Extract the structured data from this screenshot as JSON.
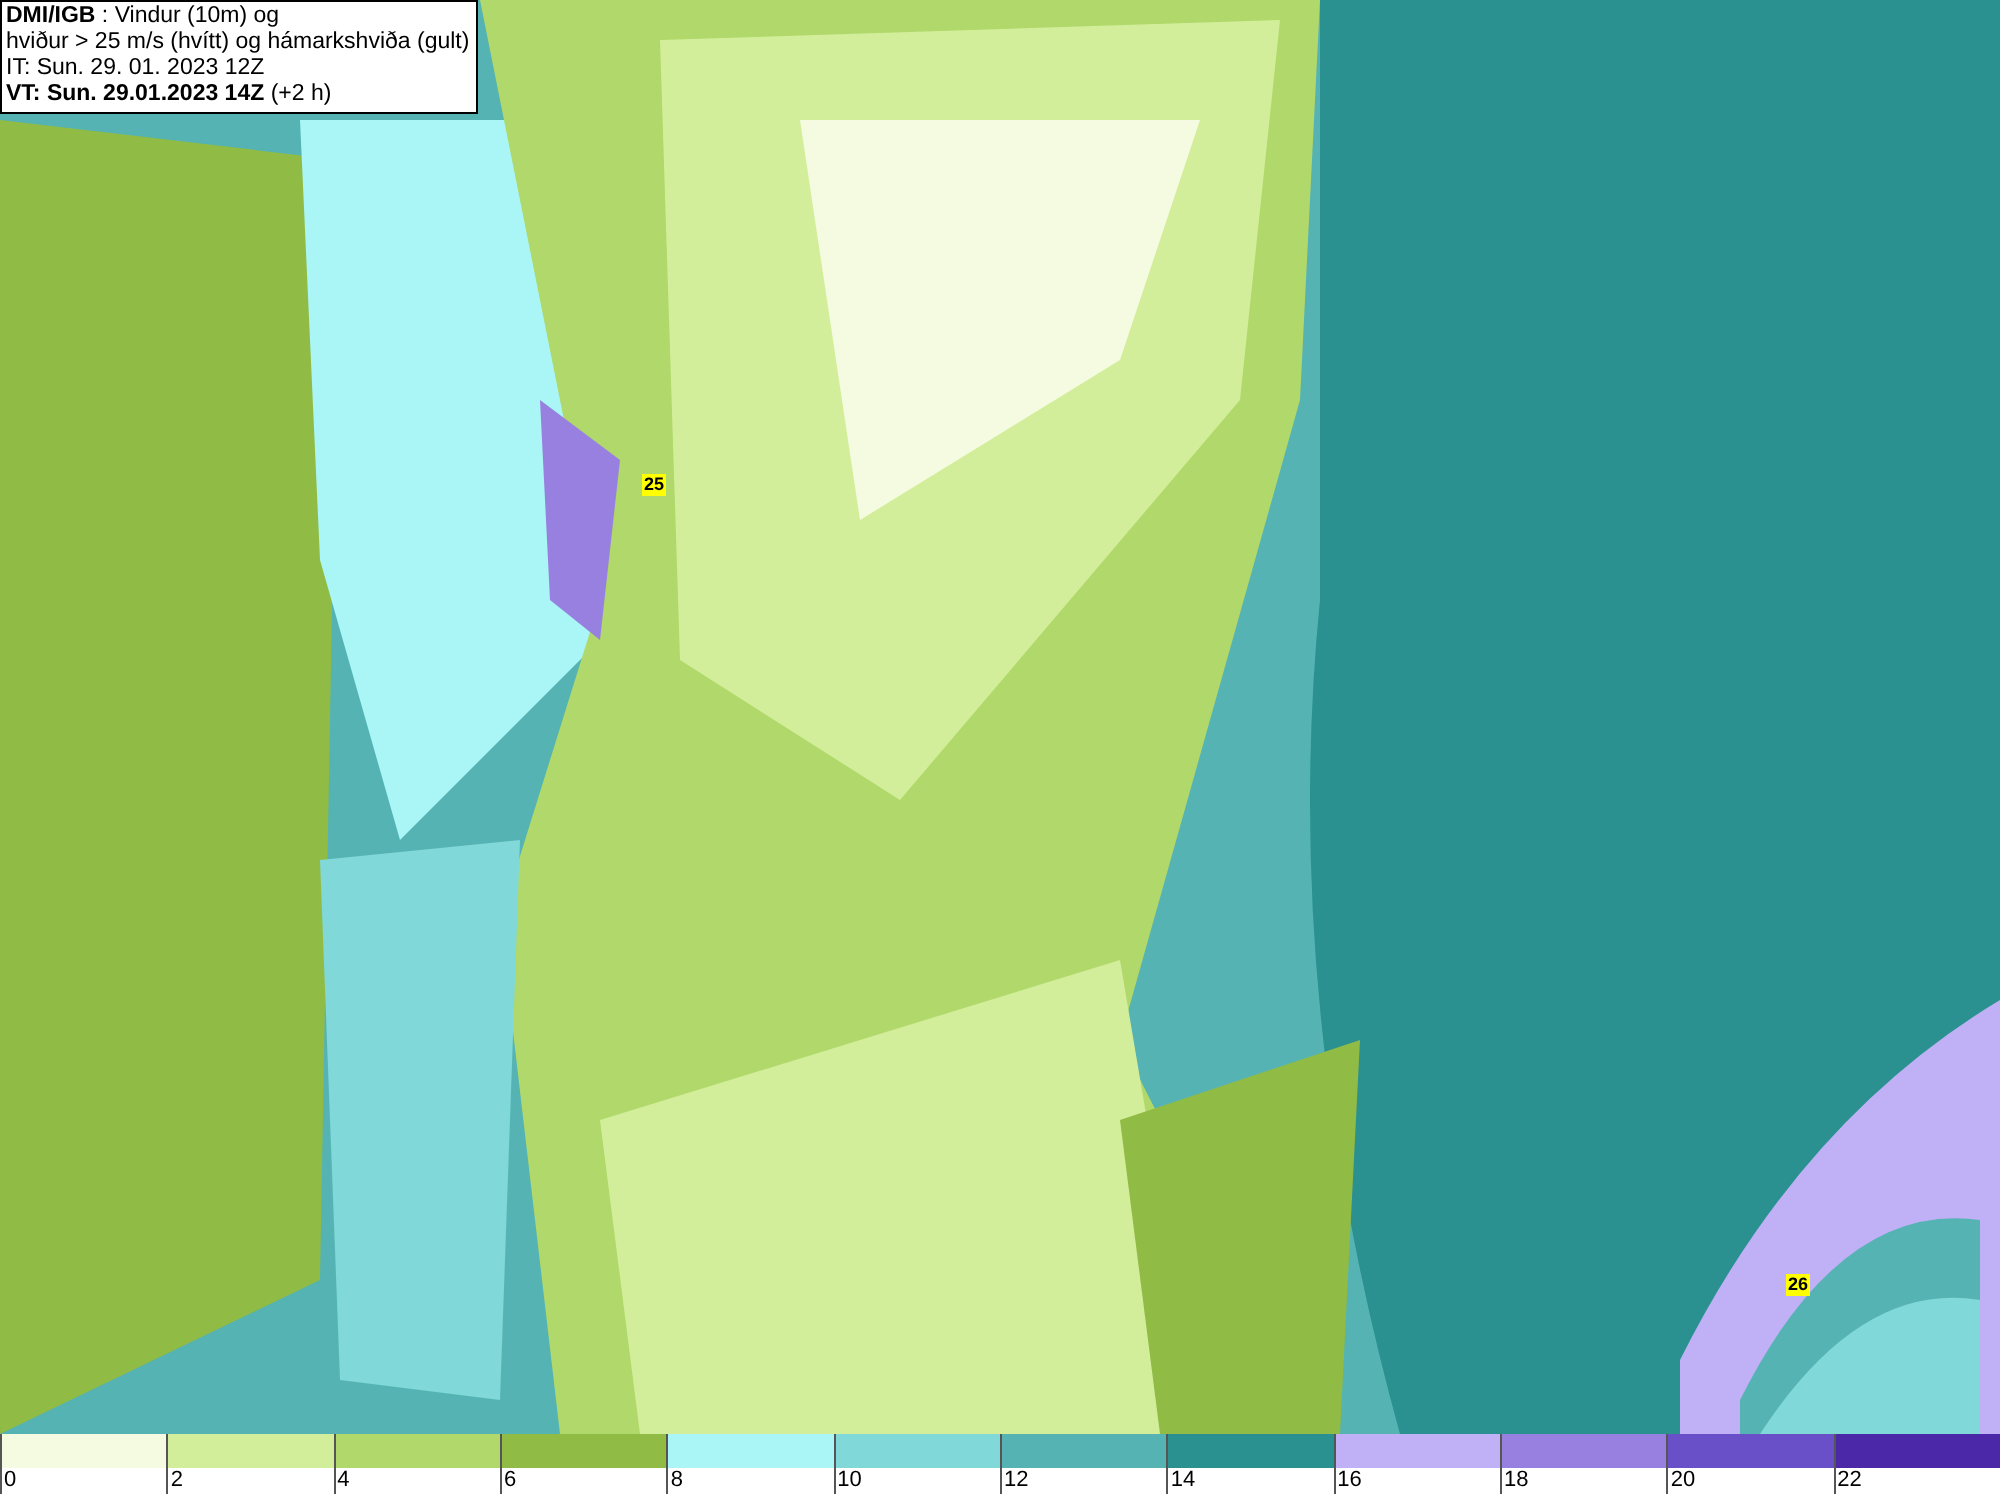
{
  "header": {
    "lines": [
      "**DMI/IGB** : Vindur (10m) og",
      "hviður > 25 m/s (hvítt) og hámarkshviða (gult)",
      "IT: Sun. 29. 01. 2023 12Z",
      "**VT: Sun. 29.01.2023 14Z** (+2 h)"
    ]
  },
  "map_labels": [
    {
      "text": "25"
    },
    {
      "text": "26"
    }
  ],
  "legend": {
    "bins": [
      {
        "color": "#f5fbe0"
      },
      {
        "color": "#d3ee9a"
      },
      {
        "color": "#b0d86a"
      },
      {
        "color": "#90bb45"
      },
      {
        "color": "#aaf6f6"
      },
      {
        "color": "#80d8d8"
      },
      {
        "color": "#55b3b3"
      },
      {
        "color": "#2a9090"
      },
      {
        "color": "#c0b0f5"
      },
      {
        "color": "#9880e0"
      },
      {
        "color": "#6a50c8"
      },
      {
        "color": "#4a28a8"
      }
    ],
    "ticks": [
      "0",
      "2",
      "4",
      "6",
      "8",
      "10",
      "12",
      "14",
      "16",
      "18",
      "20",
      "22"
    ]
  }
}
